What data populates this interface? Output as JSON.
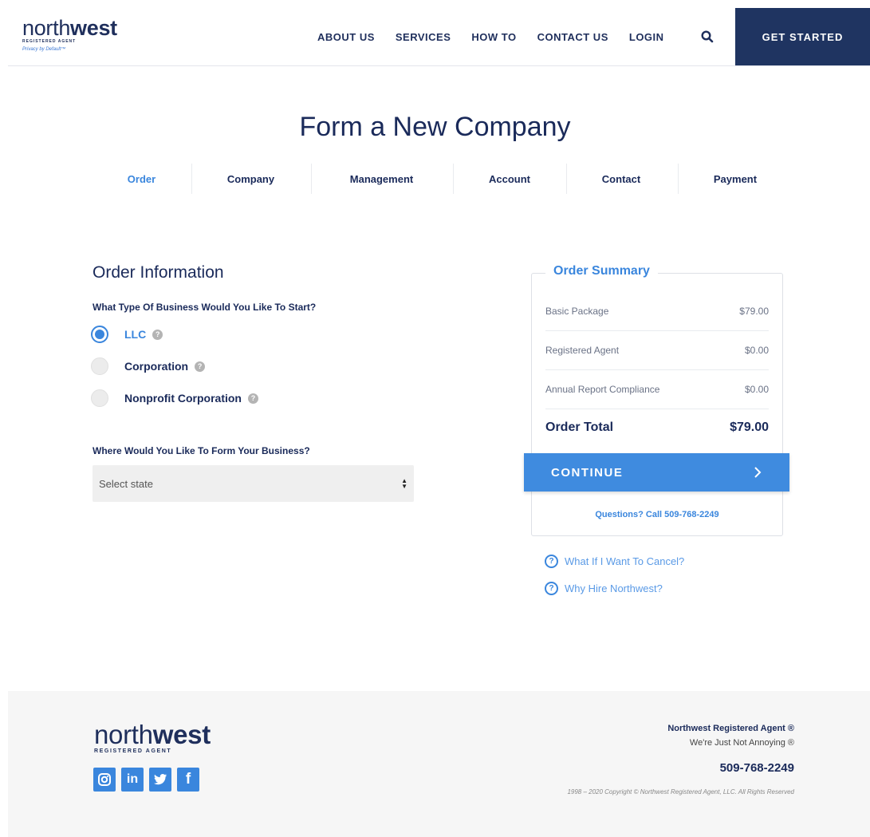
{
  "header": {
    "logo": {
      "word_light": "north",
      "word_bold": "west",
      "sub": "REGISTERED AGENT",
      "tagline": "Privacy by Default™"
    },
    "nav": [
      "ABOUT US",
      "SERVICES",
      "HOW TO",
      "CONTACT US",
      "LOGIN"
    ],
    "search_icon": "search-icon",
    "cta_label": "GET STARTED"
  },
  "page": {
    "title": "Form a New Company",
    "steps": [
      "Order",
      "Company",
      "Management",
      "Account",
      "Contact",
      "Payment"
    ],
    "active_step": "Order"
  },
  "order_info": {
    "title": "Order Information",
    "business_type_question": "What Type Of Business Would You Like To Start?",
    "business_types": [
      {
        "label": "LLC",
        "selected": true
      },
      {
        "label": "Corporation",
        "selected": false
      },
      {
        "label": "Nonprofit Corporation",
        "selected": false
      }
    ],
    "state_question": "Where Would You Like To Form Your Business?",
    "state_select": {
      "value": "Select state"
    }
  },
  "summary": {
    "title": "Order Summary",
    "items": [
      {
        "label": "Basic Package",
        "price": "$79.00"
      },
      {
        "label": "Registered Agent",
        "price": "$0.00"
      },
      {
        "label": "Annual Report Compliance",
        "price": "$0.00"
      }
    ],
    "total_label": "Order Total",
    "total_value": "$79.00",
    "continue_label": "CONTINUE",
    "questions": "Questions? Call 509-768-2249",
    "faqs": [
      "What If I Want To Cancel?",
      "Why Hire Northwest?"
    ]
  },
  "footer": {
    "logo": {
      "word_light": "north",
      "word_bold": "west",
      "sub": "REGISTERED AGENT"
    },
    "socials": [
      "instagram-icon",
      "linkedin-icon",
      "twitter-icon",
      "facebook-icon"
    ],
    "company": "Northwest Registered Agent ®",
    "tagline": "We're Just Not Annoying ®",
    "phone": "509-768-2249",
    "copyright": "1998 – 2020 Copyright © Northwest Registered Agent, LLC. All Rights Reserved"
  },
  "colors": {
    "navy": "#1f3461",
    "accent_blue": "#3f8bdf",
    "footer_bg": "#f6f6f6"
  }
}
